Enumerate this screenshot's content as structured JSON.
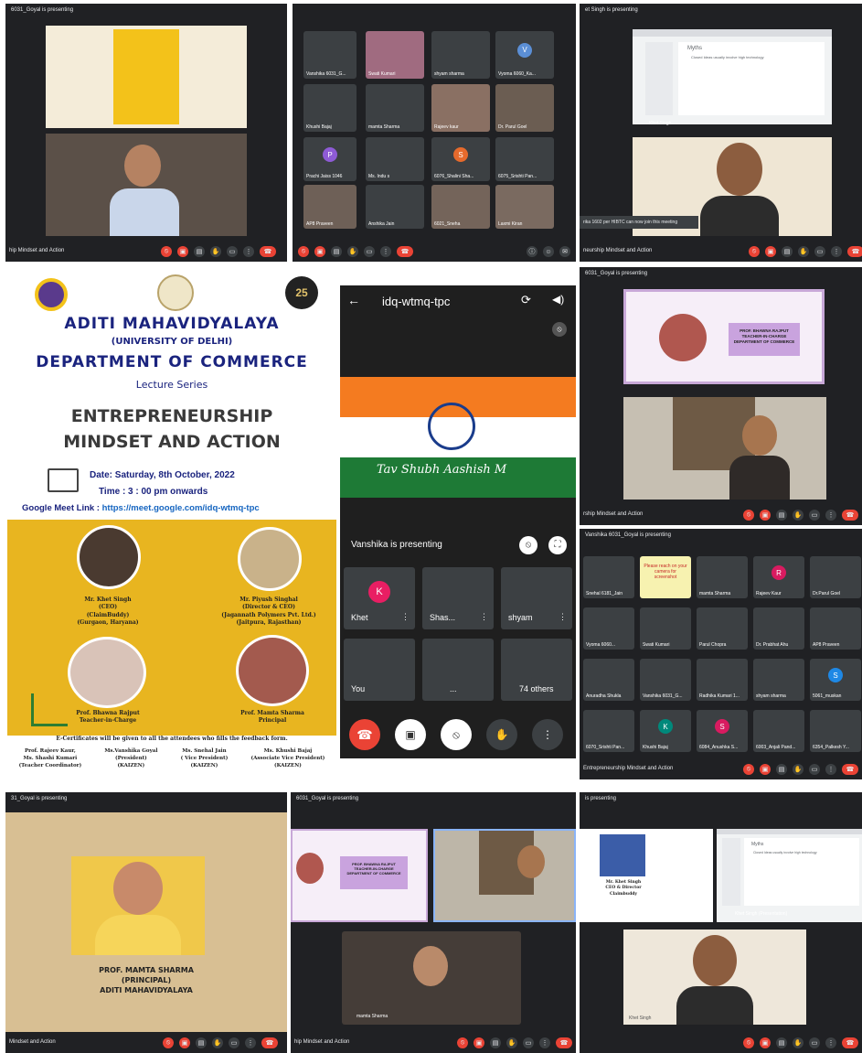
{
  "colors": {
    "meet_dark": "#202124",
    "tile": "#3c4043",
    "red": "#ea4335",
    "poster_yellow": "#e8b520",
    "poster_blue": "#1a237e"
  },
  "panel1": {
    "title": "6031_Goyal is presenting",
    "bottom": "hip Mindset and Action"
  },
  "panel2": {
    "tiles": [
      "Vanshika 6031_G...",
      "Swati Kumari",
      "shyam sharma",
      "Vyoma 6060_Ka...",
      "Khushi Bajaj",
      "mamta Sharma",
      "Rajeev kaur",
      "Dr. Parul Goel",
      "Prachi Jaiss 1046",
      "Ms. Indu s",
      "6076_Shalini Sha...",
      "6075_Srishti Pan...",
      "AP8 Praveen",
      "Anshika Jain",
      "6021_Sneha",
      "Laxmi Kiran"
    ],
    "avatars": {
      "vyoma": "V",
      "prachi": "P",
      "shalini": "S"
    }
  },
  "panel3": {
    "title": "et Singh is presenting",
    "slide_title": "Myths",
    "slide_bullet": "Closed Ideas usually involve high technology",
    "toast": "rika 1602 per HIBTC can now join this meeting",
    "bottom": "neurship Mindset and Action",
    "presenter_label": "Khet Singh"
  },
  "poster": {
    "college": "ADITI MAHAVIDYALAYA",
    "university": "(UNIVERSITY OF DELHI)",
    "dept": "DEPARTMENT OF COMMERCE",
    "series": "Lecture Series",
    "topic1": "ENTREPRENEURSHIP",
    "topic2": "MINDSET AND ACTION",
    "date": "Date: Saturday, 8th October, 2022",
    "time": "Time : 3 : 00 pm onwards",
    "link_label": "Google Meet Link : ",
    "link": "https://meet.google.com/idq-wtmq-tpc",
    "badge": "25",
    "speakers": [
      {
        "name": "Mr. Khet Singh",
        "l2": "(CEO)",
        "l3": "(ClaimBuddy)",
        "l4": "(Gurgaon, Haryana)"
      },
      {
        "name": "Mr. Piyush Singhal",
        "l2": "(Director & CEO)",
        "l3": "(Jagannath Polymers Pvt. Ltd.)",
        "l4": "(Jaitpura, Rajasthan)"
      },
      {
        "name": "Prof. Bhawna Rajput",
        "l2": "Teacher-in-Charge"
      },
      {
        "name": "Prof. Mamta Sharma",
        "l2": "Principal"
      }
    ],
    "certificate": "E-Certificates will be given to all the attendees who fills the feedback form.",
    "footer": [
      {
        "l1": "Prof. Rajeev Kaur,",
        "l2": "Ms. Shashi Kumari",
        "l3": "(Teacher Coordinator)"
      },
      {
        "l1": "Ms.Vanshika Goyal",
        "l2": "(President)",
        "l3": "(KAIZEN)"
      },
      {
        "l1": "Ms. Snehal Jain",
        "l2": "( Vice President)",
        "l3": "(KAIZEN)"
      },
      {
        "l1": "Ms. Khushi Bajaj",
        "l2": "(Associate Vice President)",
        "l3": "(KAIZEN)"
      }
    ]
  },
  "phone": {
    "meeting_code": "idq-wtmq-tpc",
    "flag_caption": "Tav Shubh Aashish M",
    "presenting": "Vanshika is presenting",
    "tiles": [
      {
        "name": "Khet",
        "avatar": "K"
      },
      {
        "name": "Shas..."
      },
      {
        "name": "shyam"
      },
      {
        "name": "You"
      },
      {
        "name": "..."
      },
      {
        "name": "74 others"
      }
    ]
  },
  "panel5": {
    "title": "6031_Goyal is presenting",
    "slide_l1": "PROF. BHAWNA RAJPUT",
    "slide_l2": "TEACHER-IN-CHARGE",
    "slide_l3": "DEPARTMENT OF COMMERCE",
    "bottom": "rship Mindset and Action"
  },
  "panel6": {
    "title": "Vanshika 6031_Goyal is presenting",
    "bottom": "Entrepreneurship Mindset and Action",
    "tiles": [
      "Snehal 6181_Jain",
      "Please reach on your camera for screenshot",
      "mamta Sharma",
      "Rajeev Kaur",
      "Dr.Parul Goel",
      "Vyoma 6060...",
      "Swati Kumari",
      "Parul Chopra",
      "Dr. Prabhat Ahu",
      "AP8 Praveen",
      "Anuradha Shukla",
      "Vanshika 6031_G...",
      "Radhika Kumari 1...",
      "shyam sharma",
      "5061_muskan",
      "6070_Srishti Pan...",
      "Khushi Bajaj",
      "6084_Anushka S...",
      "6003_Anjali Pand...",
      "6354_Palkesh Y..."
    ],
    "avatars": {
      "rajeev": "R",
      "khushi": "K",
      "anushka": "S",
      "muskan": "S"
    }
  },
  "panel7": {
    "title": "31_Goyal is presenting",
    "l1": "PROF. MAMTA SHARMA",
    "l2": "(PRINCIPAL)",
    "l3": "ADITI MAHAVIDYALAYA",
    "bottom": "Mindset and Action"
  },
  "panel8": {
    "title": "6031_Goyal is presenting",
    "slide_l1": "PROF. BHAWNA RAJPUT",
    "slide_l2": "TEACHER-IN-CHARGE",
    "slide_l3": "DEPARTMENT OF COMMERCE",
    "tile_name": "mamta Sharma",
    "bottom": "hip Mindset and Action"
  },
  "panel9": {
    "title": "is presenting",
    "card_l1": "Mr. Khet Singh",
    "card_l2": "CEO & Director",
    "card_l3": "Claimbuddy",
    "slide_title": "Myths",
    "slide_bullet": "Closed Ideas usually involve high technology",
    "presenter_label": "Khet Singh (Presentation)",
    "tile_name": "Khet Singh"
  }
}
